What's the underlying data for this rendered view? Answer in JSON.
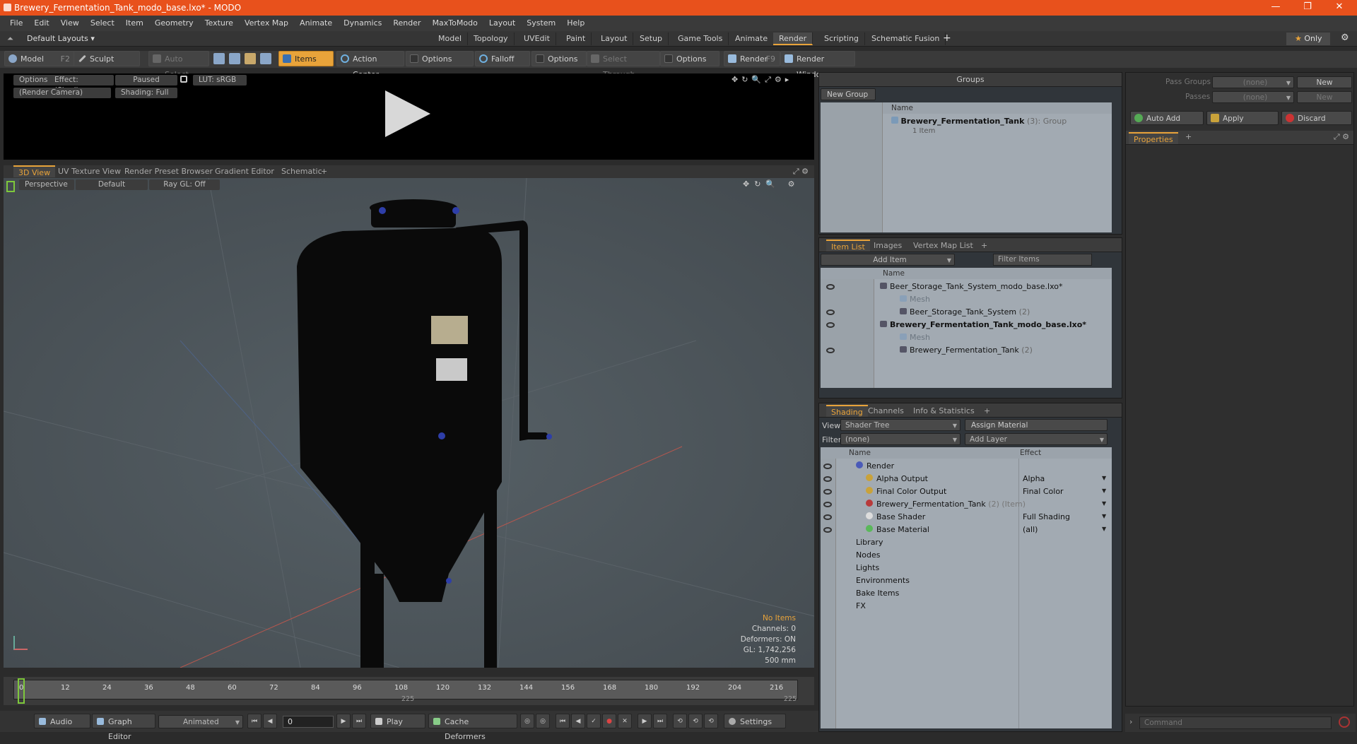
{
  "window": {
    "title": "Brewery_Fermentation_Tank_modo_base.lxo* - MODO"
  },
  "menu": [
    "File",
    "Edit",
    "View",
    "Select",
    "Item",
    "Geometry",
    "Texture",
    "Vertex Map",
    "Animate",
    "Dynamics",
    "Render",
    "MaxToModo",
    "Layout",
    "System",
    "Help"
  ],
  "layouts": {
    "label": "Default Layouts",
    "tabs": [
      "Model",
      "Topology",
      "UVEdit",
      "Paint",
      "Layout",
      "Setup",
      "Game Tools",
      "Animate",
      "Render",
      "Scripting",
      "Schematic Fusion"
    ],
    "active": "Render",
    "only": "Only"
  },
  "toolbar": {
    "model": "Model",
    "model_key": "F2",
    "sculpt": "Sculpt",
    "auto_select": "Auto Select",
    "items": "Items",
    "action_center": "Action Center",
    "options1": "Options",
    "falloff": "Falloff",
    "options2": "Options",
    "select_through": "Select Through",
    "options3": "Options",
    "render": "Render",
    "render_key": "F9",
    "render_window": "Render Window"
  },
  "preview": {
    "options": "Options",
    "effect": "Effect: (Shadi...",
    "paused": "Paused",
    "lut": "LUT: sRGB",
    "camera": "(Render Camera)",
    "shading": "Shading: Full"
  },
  "viewport": {
    "tabs": [
      "3D View",
      "UV Texture View",
      "Render Preset Browser",
      "Gradient Editor",
      "Schematic"
    ],
    "perspective": "Perspective",
    "default": "Default",
    "raygl": "Ray GL: Off",
    "info": {
      "no_items": "No Items",
      "channels": "Channels: 0",
      "deformers": "Deformers: ON",
      "gl": "GL: 1,742,256",
      "size": "500 mm"
    }
  },
  "timeline": {
    "ticks": [
      "0",
      "12",
      "24",
      "36",
      "48",
      "60",
      "72",
      "84",
      "96",
      "108",
      "120",
      "132",
      "144",
      "156",
      "168",
      "180",
      "192",
      "204",
      "216"
    ],
    "end1": "225",
    "end2": "225"
  },
  "bottom": {
    "audio": "Audio",
    "graph": "Graph Editor",
    "animated": "Animated",
    "frame": "0",
    "play": "Play",
    "cache": "Cache Deformers",
    "settings": "Settings"
  },
  "groups": {
    "title": "Groups",
    "new_group": "New Group",
    "col_name": "Name",
    "item_name": "Brewery_Fermentation_Tank",
    "item_count": "(3)",
    "item_type": ": Group",
    "item_sub": "1 Item"
  },
  "itemlist": {
    "tabs": [
      "Item List",
      "Images",
      "Vertex Map List"
    ],
    "add_item": "Add Item",
    "filter": "Filter Items",
    "col_name": "Name",
    "rows": [
      {
        "label": "Beer_Storage_Tank_System_modo_base.lxo*",
        "indent": 0,
        "bold": false,
        "dim": false
      },
      {
        "label": "Mesh",
        "indent": 1,
        "bold": false,
        "dim": true
      },
      {
        "label": "Beer_Storage_Tank_System",
        "suffix": "(2)",
        "indent": 1,
        "bold": false,
        "dim": false
      },
      {
        "label": "Brewery_Fermentation_Tank_modo_base.lxo*",
        "indent": 0,
        "bold": true,
        "dim": false
      },
      {
        "label": "Mesh",
        "indent": 1,
        "bold": false,
        "dim": true
      },
      {
        "label": "Brewery_Fermentation_Tank",
        "suffix": "(2)",
        "indent": 1,
        "bold": false,
        "dim": false
      }
    ]
  },
  "shading": {
    "tabs": [
      "Shading",
      "Channels",
      "Info & Statistics"
    ],
    "view_label": "View",
    "view_value": "Shader Tree",
    "assign": "Assign Material",
    "filter_label": "Filter",
    "filter_value": "(none)",
    "add_layer": "Add Layer",
    "col_name": "Name",
    "col_effect": "Effect",
    "rows": [
      {
        "name": "Render",
        "effect": "",
        "indent": 0
      },
      {
        "name": "Alpha Output",
        "effect": "Alpha",
        "indent": 1
      },
      {
        "name": "Final Color Output",
        "effect": "Final Color",
        "indent": 1
      },
      {
        "name": "Brewery_Fermentation_Tank",
        "suffix": "(2) (Item)",
        "effect": "",
        "indent": 1
      },
      {
        "name": "Base Shader",
        "effect": "Full Shading",
        "indent": 1
      },
      {
        "name": "Base Material",
        "effect": "(all)",
        "indent": 1
      },
      {
        "name": "Library",
        "effect": "",
        "indent": 0
      },
      {
        "name": "Nodes",
        "effect": "",
        "indent": 0
      },
      {
        "name": "Lights",
        "effect": "",
        "indent": 0
      },
      {
        "name": "Environments",
        "effect": "",
        "indent": 0
      },
      {
        "name": "Bake Items",
        "effect": "",
        "indent": 0
      },
      {
        "name": "FX",
        "effect": "",
        "indent": 0
      }
    ]
  },
  "passes": {
    "pass_groups": "Pass Groups",
    "passes": "Passes",
    "none": "(none)",
    "new": "New",
    "auto_add": "Auto Add",
    "apply": "Apply",
    "discard": "Discard",
    "properties": "Properties"
  },
  "command": {
    "placeholder": "Command"
  }
}
